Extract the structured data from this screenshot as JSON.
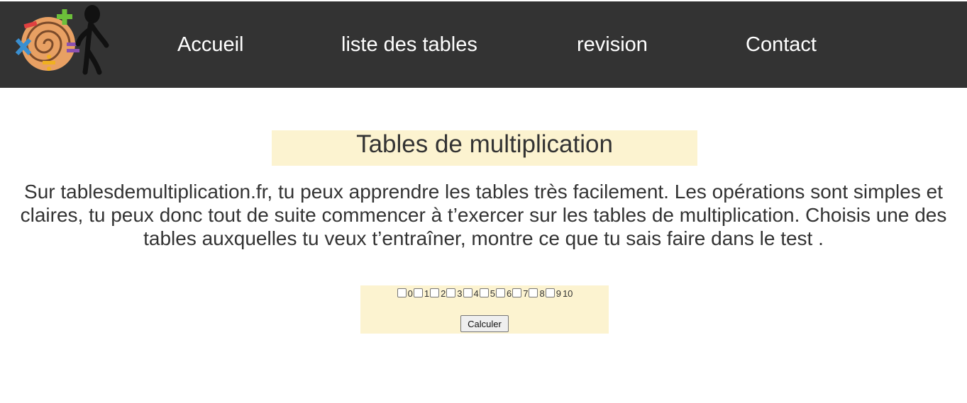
{
  "nav": {
    "items": [
      {
        "label": "Accueil"
      },
      {
        "label": "liste des tables"
      },
      {
        "label": "revision"
      },
      {
        "label": "Contact"
      }
    ]
  },
  "logo": {
    "icon": "math-logo-icon",
    "symbols": [
      "×",
      "+",
      "÷",
      "="
    ]
  },
  "main": {
    "title": "Tables de multiplication",
    "intro": "Sur tablesdemultiplication.fr, tu peux apprendre les tables très facilement. Les opérations sont simples et claires, tu peux donc tout de suite commencer à t’exercer sur les tables de multiplication. Choisis une des tables auxquelles tu veux t’entraîner, montre ce que tu sais faire dans le test ."
  },
  "form": {
    "tables": [
      "0",
      "1",
      "2",
      "3",
      "4",
      "5",
      "6",
      "7",
      "8",
      "9",
      "10"
    ],
    "submit_label": "Calculer"
  },
  "colors": {
    "navbar": "#333333",
    "panel": "#fcf3d0",
    "text": "#333333"
  }
}
